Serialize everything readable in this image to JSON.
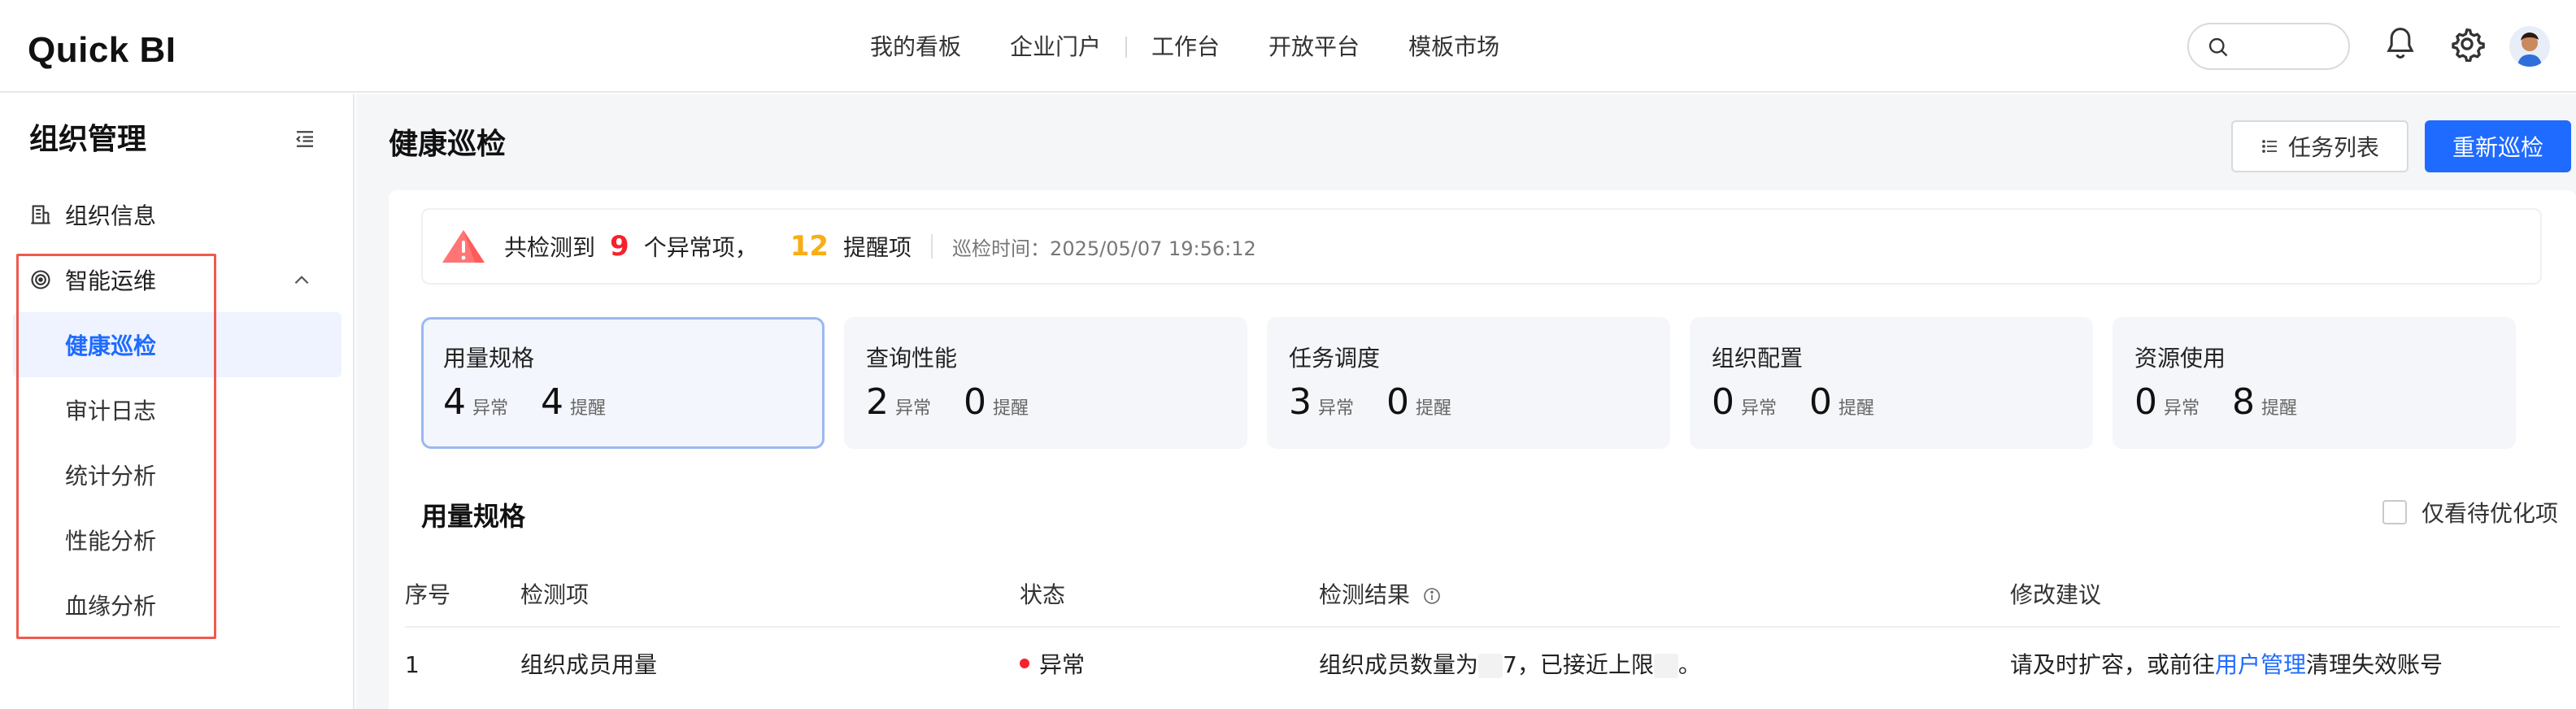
{
  "header": {
    "logo": "Quick BI",
    "nav": [
      "我的看板",
      "企业门户",
      "工作台",
      "开放平台",
      "模板市场"
    ],
    "search_placeholder": ""
  },
  "sidebar": {
    "title": "组织管理",
    "items": [
      {
        "label": "组织信息",
        "icon": "building-icon"
      },
      {
        "label": "智能运维",
        "icon": "target-icon",
        "expanded": true,
        "children": [
          "健康巡检",
          "审计日志",
          "统计分析",
          "性能分析",
          "血缘分析"
        ],
        "active_child": "健康巡检"
      }
    ]
  },
  "main": {
    "title": "健康巡检",
    "buttons": {
      "task_list": "任务列表",
      "rerun": "重新巡检"
    },
    "alert": {
      "prefix": "共检测到",
      "abnormal_count": "9",
      "abnormal_label": "个异常项，",
      "remind_count": "12",
      "remind_label": "提醒项",
      "time_label": "巡检时间：2025/05/07 19:56:12"
    },
    "cards": [
      {
        "title": "用量规格",
        "abnormal": "4",
        "remind": "4",
        "active": true
      },
      {
        "title": "查询性能",
        "abnormal": "2",
        "remind": "0"
      },
      {
        "title": "任务调度",
        "abnormal": "3",
        "remind": "0"
      },
      {
        "title": "组织配置",
        "abnormal": "0",
        "remind": "0"
      },
      {
        "title": "资源使用",
        "abnormal": "0",
        "remind": "8"
      }
    ],
    "card_units": {
      "abnormal": "异常",
      "remind": "提醒"
    },
    "section_title": "用量规格",
    "only_pending_label": "仅看待优化项",
    "table": {
      "columns": [
        "序号",
        "检测项",
        "状态",
        "检测结果",
        "修改建议"
      ],
      "rows": [
        {
          "index": "1",
          "item": "组织成员用量",
          "status": "异常",
          "result_prefix": "组织成员数量为",
          "result_middle": "7，已接近上限",
          "result_suffix": "。",
          "advice_prefix": "请及时扩容，或前往",
          "advice_link": "用户管理",
          "advice_suffix": "清理失效账号"
        }
      ]
    }
  },
  "colors": {
    "primary": "#1f6bff",
    "danger": "#f5222d",
    "warning": "#faad14",
    "highlight_frame": "#ee5a4f"
  }
}
